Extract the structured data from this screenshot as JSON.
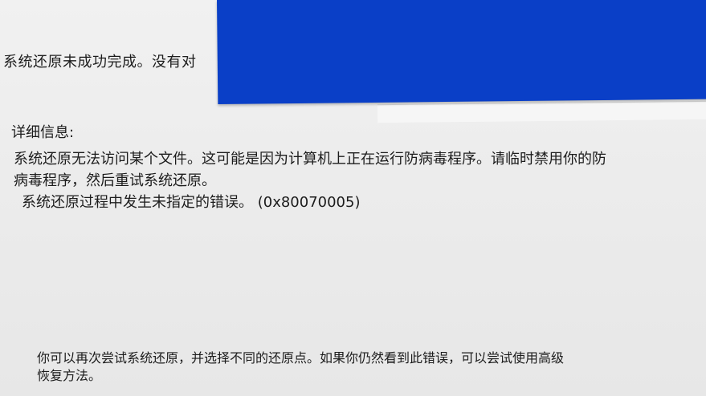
{
  "dialog": {
    "summary_text": "系统还原未成功完成。没有对",
    "details_header": "详细信息:",
    "details_lines": [
      "系统还原无法访问某个文件。这可能是因为计算机上正在运行防病毒程序。请临时禁用你的防",
      "病毒程序，然后重试系统还原。",
      "系统还原过程中发生未指定的错误。 (0x80070005)"
    ],
    "footer_lines": [
      "你可以再次尝试系统还原，并选择不同的还原点。如果你仍然看到此错误，可以尝试使用高级",
      "恢复方法。"
    ]
  },
  "colors": {
    "overlay_window": "#0a3fc7",
    "background": "#ececec",
    "text": "#1c1c1c"
  }
}
